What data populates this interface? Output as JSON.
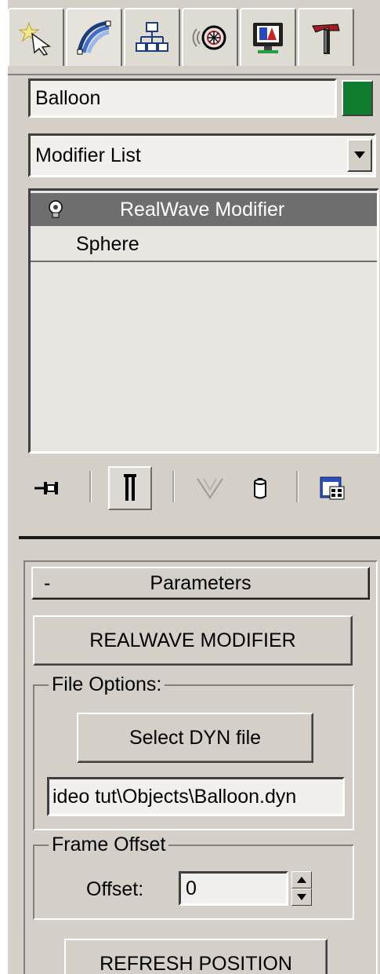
{
  "tabs": [
    {
      "icon": "create-icon",
      "active": false
    },
    {
      "icon": "modify-icon",
      "active": true
    },
    {
      "icon": "hierarchy-icon",
      "active": false
    },
    {
      "icon": "motion-icon",
      "active": false
    },
    {
      "icon": "display-icon",
      "active": false
    },
    {
      "icon": "utilities-icon",
      "active": false
    }
  ],
  "object": {
    "name": "Balloon",
    "color": "#0f7b2e"
  },
  "modifier_list": {
    "selected": "Modifier List"
  },
  "stack": {
    "items": [
      {
        "label": "RealWave Modifier",
        "selected": true
      },
      {
        "label": "Sphere",
        "selected": false
      }
    ]
  },
  "stack_tools": [
    {
      "icon": "pin-stack-icon"
    },
    {
      "icon": "show-end-result-icon"
    },
    {
      "icon": "make-unique-icon"
    },
    {
      "icon": "remove-modifier-icon"
    },
    {
      "icon": "configure-modifier-sets-icon"
    }
  ],
  "rollout": {
    "collapse_symbol": "-",
    "title": "Parameters",
    "realwave_button": "REALWAVE MODIFIER",
    "file_options": {
      "title": "File Options:",
      "select_button": "Select DYN file",
      "path": "ideo tut\\Objects\\Balloon.dyn"
    },
    "frame_offset": {
      "title": "Frame Offset",
      "label": "Offset:",
      "value": "0"
    },
    "refresh_button": "REFRESH POSITION"
  }
}
